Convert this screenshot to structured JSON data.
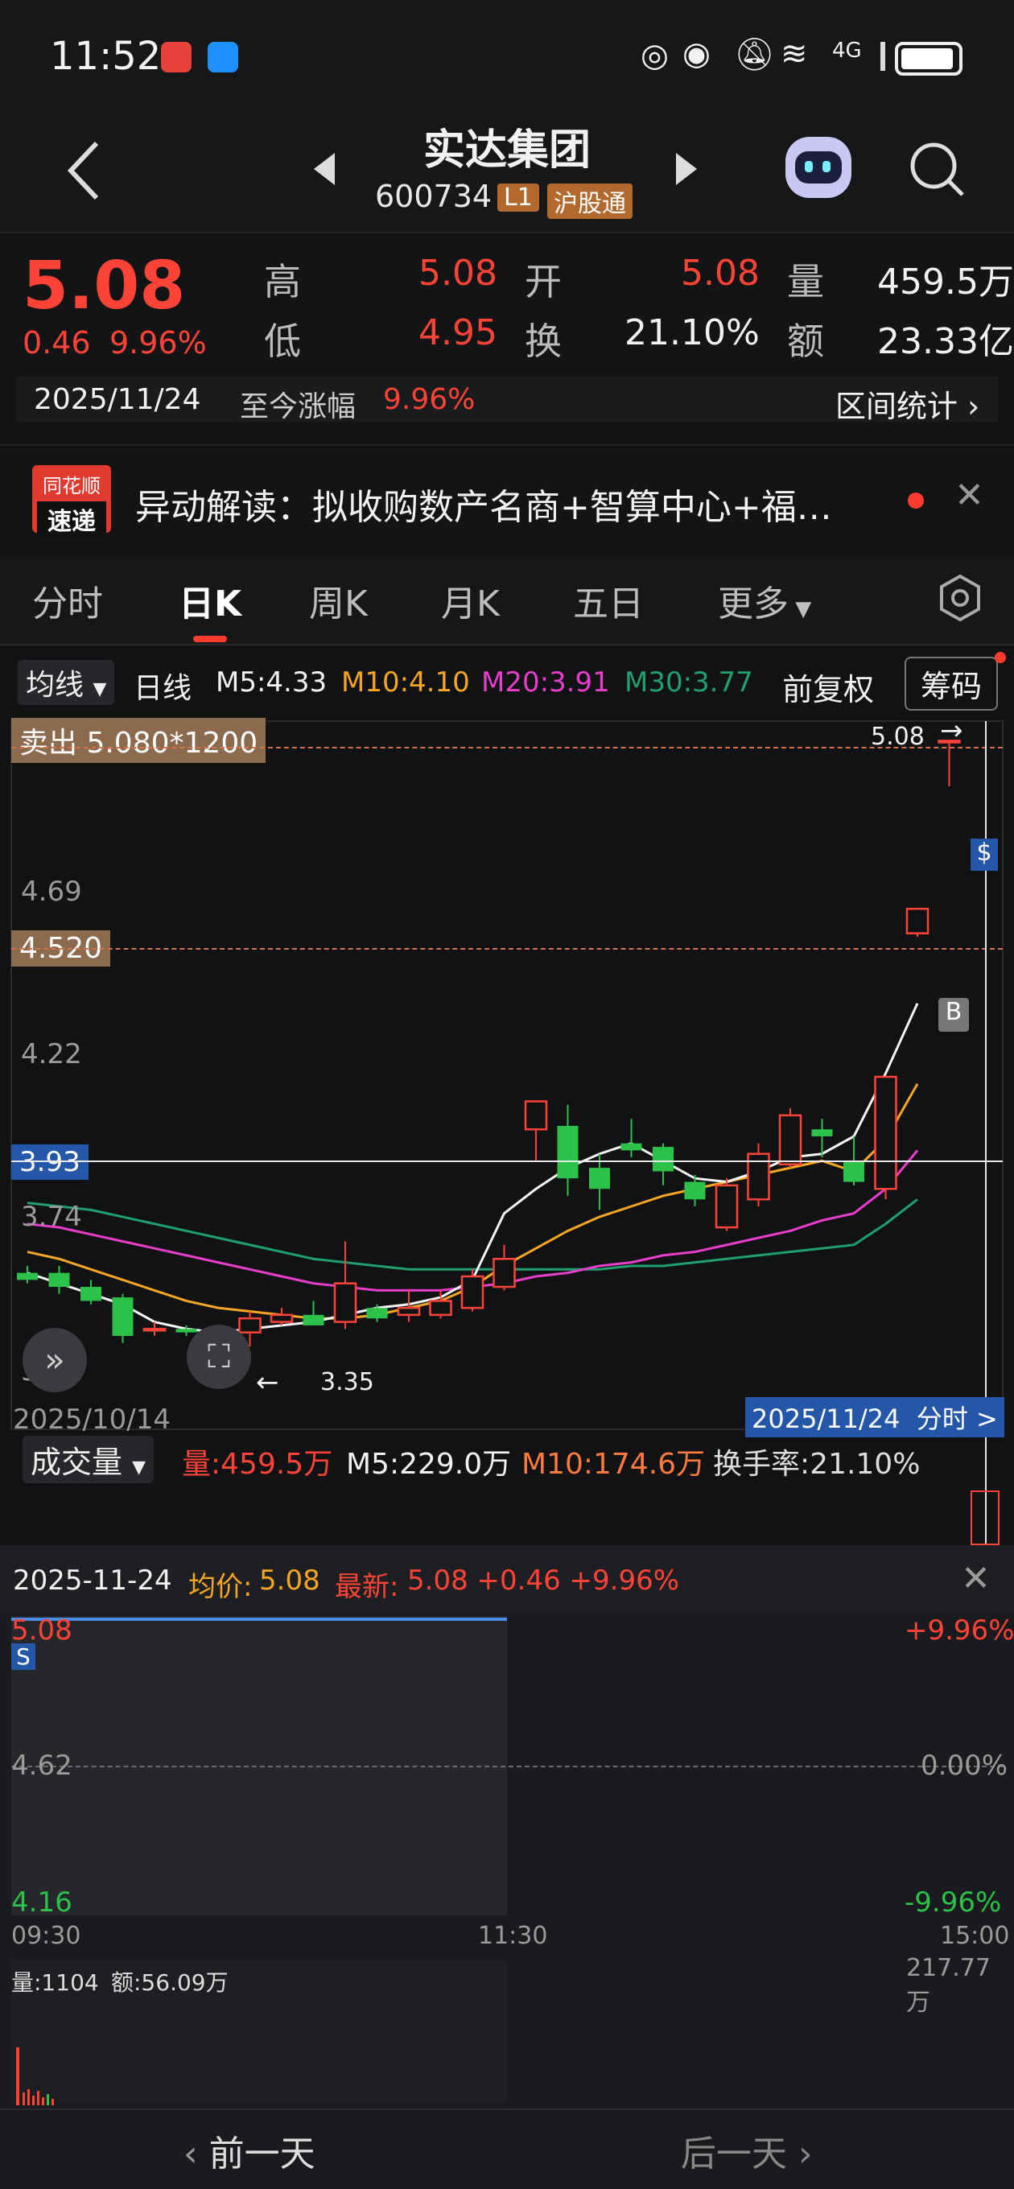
{
  "status_bar": {
    "time": "11:52",
    "network": "4G"
  },
  "header": {
    "title": "实达集团",
    "code": "600734",
    "level_badge": "L1",
    "connect_badge": "沪股通"
  },
  "quote": {
    "price": "5.08",
    "change": "0.46",
    "change_pct": "9.96%",
    "high_label": "高",
    "high": "5.08",
    "low_label": "低",
    "low": "4.95",
    "open_label": "开",
    "open": "5.08",
    "turnover_label": "换",
    "turnover": "21.10%",
    "volume_label": "量",
    "volume": "459.5万",
    "amount_label": "额",
    "amount": "23.33亿",
    "date": "2025/11/24",
    "since_label": "至今涨幅",
    "since_value": "9.96%",
    "range_stats": "区间统计"
  },
  "news": {
    "logo_top": "同花顺",
    "logo_bottom": "速递",
    "text": "异动解读：拟收购数产名商+智算中心+福…"
  },
  "tabs": [
    "分时",
    "日K",
    "周K",
    "月K",
    "五日",
    "更多"
  ],
  "active_tab": 1,
  "ma_bar": {
    "dropdown": "均线",
    "period": "日线",
    "m5": "M5:4.33",
    "m10": "M10:4.10",
    "m20": "M20:3.91",
    "m30": "M30:3.77",
    "adjust": "前复权",
    "chips": "筹码"
  },
  "kline": {
    "sell_label": "卖出 5.080*1200",
    "price_tag": "4.520",
    "crosshair_price": "3.93",
    "high_marker": "5.08",
    "low_marker": "3.35",
    "y_ticks": [
      "4.69",
      "4.22",
      "3.74",
      "3.27"
    ],
    "start_date": "2025/10/14",
    "end_date_btn": "2025/11/24  分时 >",
    "buy_marker": "B",
    "s_marker": "$"
  },
  "chart_data": {
    "type": "candlestick",
    "ylim": [
      3.15,
      5.15
    ],
    "candles": [
      {
        "o": 3.56,
        "h": 3.58,
        "l": 3.53,
        "c": 3.54
      },
      {
        "o": 3.56,
        "h": 3.58,
        "l": 3.5,
        "c": 3.52
      },
      {
        "o": 3.52,
        "h": 3.54,
        "l": 3.47,
        "c": 3.48
      },
      {
        "o": 3.49,
        "h": 3.5,
        "l": 3.36,
        "c": 3.38
      },
      {
        "o": 3.4,
        "h": 3.42,
        "l": 3.38,
        "c": 3.4
      },
      {
        "o": 3.4,
        "h": 3.41,
        "l": 3.38,
        "c": 3.39
      },
      {
        "o": 3.36,
        "h": 3.4,
        "l": 3.35,
        "c": 3.38
      },
      {
        "o": 3.39,
        "h": 3.45,
        "l": 3.35,
        "c": 3.43
      },
      {
        "o": 3.42,
        "h": 3.46,
        "l": 3.41,
        "c": 3.44
      },
      {
        "o": 3.44,
        "h": 3.48,
        "l": 3.42,
        "c": 3.41
      },
      {
        "o": 3.42,
        "h": 3.65,
        "l": 3.4,
        "c": 3.53
      },
      {
        "o": 3.46,
        "h": 3.47,
        "l": 3.42,
        "c": 3.43
      },
      {
        "o": 3.44,
        "h": 3.51,
        "l": 3.42,
        "c": 3.46
      },
      {
        "o": 3.44,
        "h": 3.51,
        "l": 3.43,
        "c": 3.48
      },
      {
        "o": 3.46,
        "h": 3.57,
        "l": 3.45,
        "c": 3.55
      },
      {
        "o": 3.52,
        "h": 3.64,
        "l": 3.51,
        "c": 3.6
      },
      {
        "o": 3.97,
        "h": 4.05,
        "l": 3.88,
        "c": 4.05
      },
      {
        "o": 3.98,
        "h": 4.04,
        "l": 3.78,
        "c": 3.83
      },
      {
        "o": 3.86,
        "h": 3.9,
        "l": 3.74,
        "c": 3.8
      },
      {
        "o": 3.93,
        "h": 4.0,
        "l": 3.89,
        "c": 3.91
      },
      {
        "o": 3.92,
        "h": 3.93,
        "l": 3.81,
        "c": 3.85
      },
      {
        "o": 3.82,
        "h": 3.84,
        "l": 3.75,
        "c": 3.77
      },
      {
        "o": 3.69,
        "h": 3.83,
        "l": 3.68,
        "c": 3.81
      },
      {
        "o": 3.77,
        "h": 3.93,
        "l": 3.75,
        "c": 3.9
      },
      {
        "o": 3.87,
        "h": 4.03,
        "l": 3.86,
        "c": 4.01
      },
      {
        "o": 3.97,
        "h": 4.0,
        "l": 3.89,
        "c": 3.95
      },
      {
        "o": 3.88,
        "h": 3.95,
        "l": 3.81,
        "c": 3.82
      },
      {
        "o": 3.8,
        "h": 4.12,
        "l": 3.77,
        "c": 4.12
      },
      {
        "o": 4.53,
        "h": 4.6,
        "l": 4.52,
        "c": 4.6
      },
      {
        "o": 5.08,
        "h": 5.08,
        "l": 4.95,
        "c": 5.08
      }
    ],
    "ma5": [
      3.56,
      3.53,
      3.5,
      3.47,
      3.42,
      3.4,
      3.39,
      3.4,
      3.41,
      3.42,
      3.44,
      3.46,
      3.47,
      3.49,
      3.54,
      3.73,
      3.8,
      3.86,
      3.9,
      3.93,
      3.88,
      3.83,
      3.82,
      3.85,
      3.89,
      3.9,
      3.95,
      4.13,
      4.33
    ],
    "ma10": [
      3.62,
      3.6,
      3.57,
      3.54,
      3.51,
      3.48,
      3.46,
      3.45,
      3.44,
      3.43,
      3.43,
      3.44,
      3.46,
      3.48,
      3.52,
      3.58,
      3.63,
      3.68,
      3.72,
      3.75,
      3.78,
      3.8,
      3.82,
      3.84,
      3.86,
      3.88,
      3.85,
      3.94,
      4.1
    ],
    "ma20": [
      3.7,
      3.69,
      3.67,
      3.65,
      3.63,
      3.61,
      3.59,
      3.57,
      3.55,
      3.53,
      3.52,
      3.51,
      3.51,
      3.51,
      3.52,
      3.53,
      3.55,
      3.56,
      3.58,
      3.59,
      3.61,
      3.62,
      3.64,
      3.66,
      3.68,
      3.71,
      3.73,
      3.8,
      3.91
    ],
    "ma30": [
      3.76,
      3.75,
      3.74,
      3.72,
      3.7,
      3.68,
      3.66,
      3.64,
      3.62,
      3.6,
      3.59,
      3.58,
      3.57,
      3.57,
      3.57,
      3.57,
      3.57,
      3.57,
      3.57,
      3.58,
      3.58,
      3.59,
      3.6,
      3.61,
      3.62,
      3.63,
      3.64,
      3.7,
      3.77
    ],
    "colors": {
      "up": "#ff4437",
      "down": "#2cc24a",
      "ma5": "#f5f5f5",
      "ma10": "#f6a623",
      "ma20": "#e83ecb",
      "ma30": "#1fa06c"
    }
  },
  "volume_bar": {
    "dropdown": "成交量",
    "vol": "量:459.5万",
    "m5": "M5:229.0万",
    "m10": "M10:174.6万",
    "turnover": "换手率:21.10%"
  },
  "intraday": {
    "date": "2025-11-24",
    "avg_label": "均价:",
    "avg": "5.08",
    "latest_label": "最新:",
    "latest": "5.08 +0.46 +9.96%",
    "top_price": "5.08",
    "mid_price": "4.62",
    "bot_price": "4.16",
    "top_pct": "+9.96%",
    "mid_pct": "0.00%",
    "bot_pct": "-9.96%",
    "t_start": "09:30",
    "t_mid": "11:30",
    "t_end": "15:00",
    "vol_text": "量:1104",
    "amount_text": "额:56.09万",
    "vol_max": "217.77万",
    "s_marker": "S"
  },
  "footer": {
    "prev": "前一天",
    "next": "后一天"
  }
}
